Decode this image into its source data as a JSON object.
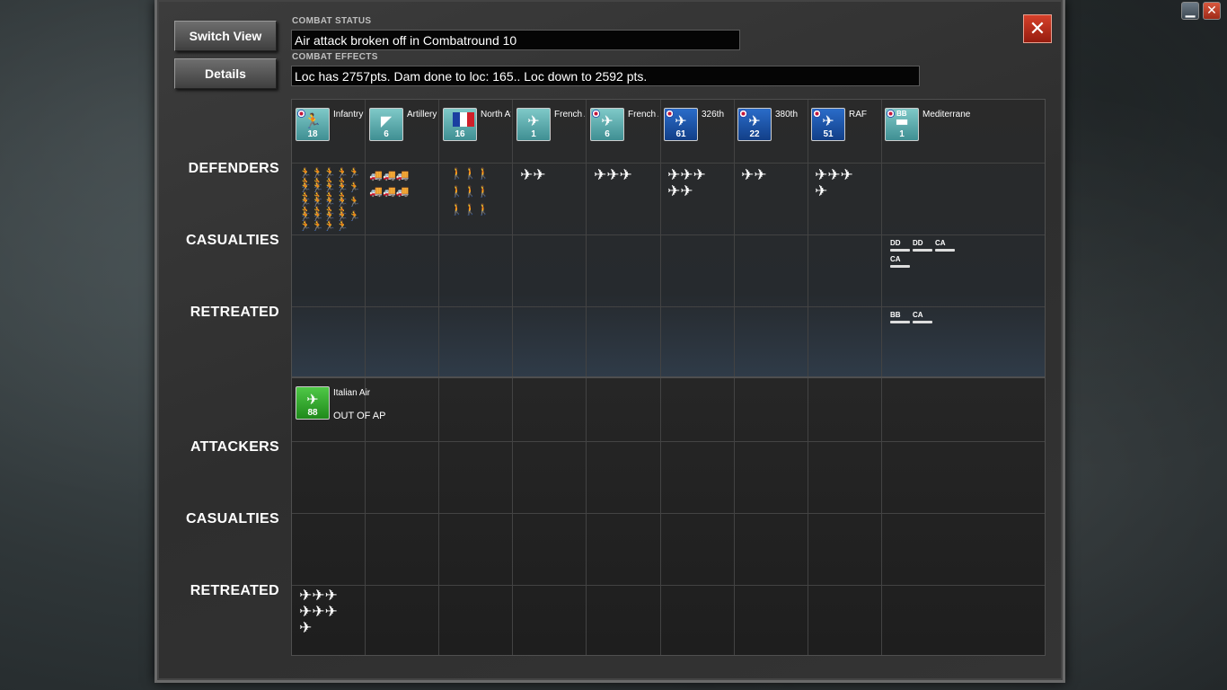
{
  "window": {
    "minimize_glyph": "▁",
    "close_glyph": "✕"
  },
  "panel": {
    "switch_view_label": "Switch View",
    "details_label": "Details",
    "close_glyph": "✕",
    "combat_status_label": "COMBAT STATUS",
    "combat_status_text": "Air attack broken off in Combatround  10",
    "combat_effects_label": "COMBAT EFFECTS",
    "combat_effects_text": "Loc has  2757pts. Dam done to loc: 165.. Loc down to 2592 pts."
  },
  "rows": {
    "defenders": "DEFENDERS",
    "casualties_def": "CASUALTIES",
    "retreated_def": "RETREATED",
    "attackers": "ATTACKERS",
    "casualties_att": "CASUALTIES",
    "retreated_att": "RETREATED"
  },
  "defender_units": [
    {
      "name": "Infantry",
      "count": "18",
      "color": "teal",
      "icon": "infantry-icon",
      "glyph": "🏃"
    },
    {
      "name": "Artillery",
      "count": "6",
      "color": "teal",
      "icon": "artillery-icon",
      "glyph": "◤"
    },
    {
      "name": "North Afr",
      "count": "16",
      "color": "teal",
      "icon": "french-flag-icon",
      "glyph": ""
    },
    {
      "name": "French A",
      "count": "1",
      "color": "teal",
      "icon": "fighter-icon",
      "glyph": "✈"
    },
    {
      "name": "French A",
      "count": "6",
      "color": "teal",
      "icon": "bomber-icon",
      "glyph": "✈"
    },
    {
      "name": "326th",
      "count": "61",
      "color": "blue",
      "icon": "bomber-icon",
      "glyph": "✈"
    },
    {
      "name": "380th",
      "count": "22",
      "color": "blue",
      "icon": "fighter-icon",
      "glyph": "✈"
    },
    {
      "name": "RAF",
      "count": "51",
      "color": "blue",
      "icon": "bomber-icon",
      "glyph": "✈"
    },
    {
      "name": "Mediterrane",
      "count": "1",
      "color": "teal",
      "icon": "battleship-icon",
      "glyph": "▬",
      "tag": "BB"
    }
  ],
  "defender_sprites": {
    "infantry": "🏃🏃🏃🏃🏃🏃🏃🏃🏃",
    "artillery": "🚚🚚🚚",
    "north_afr": "🚶🚶🚶",
    "french_fighter": "✈✈",
    "french_bomber": "✈✈✈",
    "b326": "✈✈✈",
    "b326b": "✈✈",
    "f380": "✈✈",
    "raf": "✈✈✈",
    "raf_b": "✈"
  },
  "casualty_ships": [
    "DD",
    "DD",
    "CA",
    "CA"
  ],
  "retreated_ships": [
    "BB",
    "CA"
  ],
  "attacker_units": [
    {
      "name": "Italian Air",
      "count": "88",
      "color": "green",
      "icon": "italian-bomber-icon",
      "status": "OUT OF AP"
    }
  ],
  "attacker_retreated_sprites": {
    "row1": "✈✈✈",
    "row2": "✈✈✈",
    "row3": "✈"
  }
}
